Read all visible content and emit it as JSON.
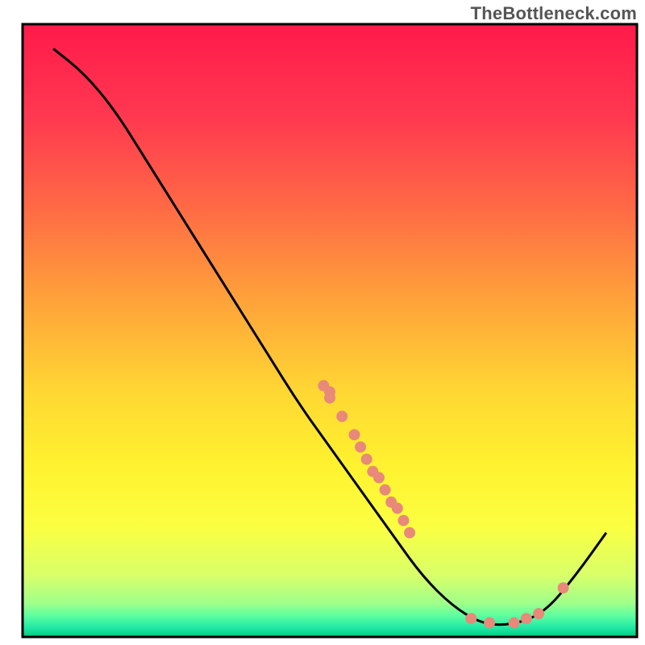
{
  "watermark": "TheBottleneck.com",
  "chart_data": {
    "type": "line",
    "title": "",
    "xlabel": "",
    "ylabel": "",
    "xlim": [
      0,
      100
    ],
    "ylim": [
      0,
      100
    ],
    "curve": [
      {
        "x": 5,
        "y": 96
      },
      {
        "x": 10,
        "y": 92
      },
      {
        "x": 15,
        "y": 86
      },
      {
        "x": 20,
        "y": 78
      },
      {
        "x": 25,
        "y": 70
      },
      {
        "x": 30,
        "y": 62
      },
      {
        "x": 35,
        "y": 54
      },
      {
        "x": 40,
        "y": 46
      },
      {
        "x": 45,
        "y": 38
      },
      {
        "x": 50,
        "y": 31
      },
      {
        "x": 55,
        "y": 24
      },
      {
        "x": 60,
        "y": 17
      },
      {
        "x": 65,
        "y": 10
      },
      {
        "x": 70,
        "y": 5
      },
      {
        "x": 75,
        "y": 2
      },
      {
        "x": 80,
        "y": 2
      },
      {
        "x": 85,
        "y": 4
      },
      {
        "x": 90,
        "y": 10
      },
      {
        "x": 95,
        "y": 17
      }
    ],
    "points": [
      {
        "x": 49,
        "y": 41
      },
      {
        "x": 50,
        "y": 40
      },
      {
        "x": 50,
        "y": 39
      },
      {
        "x": 52,
        "y": 36
      },
      {
        "x": 54,
        "y": 33
      },
      {
        "x": 55,
        "y": 31
      },
      {
        "x": 56,
        "y": 29
      },
      {
        "x": 57,
        "y": 27
      },
      {
        "x": 58,
        "y": 26
      },
      {
        "x": 59,
        "y": 24
      },
      {
        "x": 60,
        "y": 22
      },
      {
        "x": 61,
        "y": 21
      },
      {
        "x": 62,
        "y": 19
      },
      {
        "x": 63,
        "y": 17
      },
      {
        "x": 73,
        "y": 3
      },
      {
        "x": 76,
        "y": 2.3
      },
      {
        "x": 80,
        "y": 2.3
      },
      {
        "x": 82,
        "y": 3
      },
      {
        "x": 84,
        "y": 3.8
      },
      {
        "x": 88,
        "y": 8
      }
    ],
    "gradient_stops": [
      {
        "offset": 0.0,
        "color": "#ff1a4a"
      },
      {
        "offset": 0.15,
        "color": "#ff3850"
      },
      {
        "offset": 0.3,
        "color": "#ff6a45"
      },
      {
        "offset": 0.45,
        "color": "#ffa23a"
      },
      {
        "offset": 0.6,
        "color": "#ffd733"
      },
      {
        "offset": 0.72,
        "color": "#fff22f"
      },
      {
        "offset": 0.82,
        "color": "#fbff41"
      },
      {
        "offset": 0.9,
        "color": "#d8ff6a"
      },
      {
        "offset": 0.945,
        "color": "#9fff8a"
      },
      {
        "offset": 0.965,
        "color": "#5fffa0"
      },
      {
        "offset": 0.985,
        "color": "#20e8a5"
      },
      {
        "offset": 1.0,
        "color": "#00c97f"
      }
    ],
    "point_color": "#e8897a",
    "axis_color": "#000000"
  }
}
